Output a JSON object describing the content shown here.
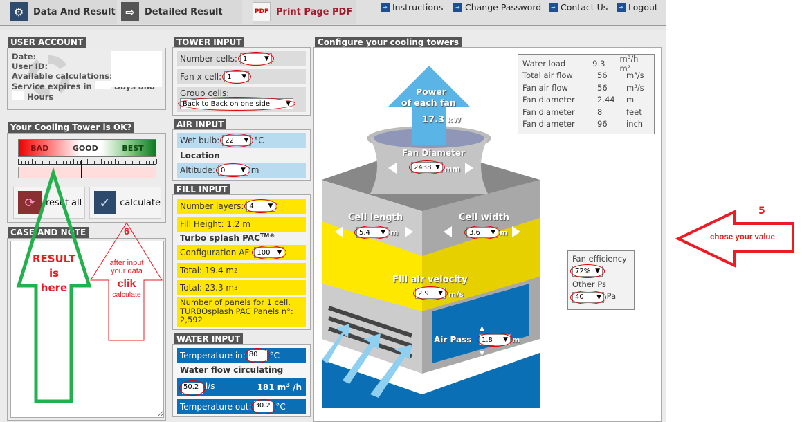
{
  "nav": {
    "tabs": [
      {
        "label": "Data And Result",
        "icon": "gear-icon"
      },
      {
        "label": "Detailed Result",
        "icon": "arrow-right-icon"
      },
      {
        "label": "Print Page PDF",
        "icon": "pdf-icon"
      }
    ],
    "links": [
      "Instructions",
      "Change Password",
      "Contact Us",
      "Logout"
    ]
  },
  "user_account": {
    "title": "USER ACCOUNT",
    "date_label": "Date:",
    "userid_label": "User ID:",
    "calcs_label": "Available calculations:",
    "expires_prefix": "Service expires in",
    "days_label": "Days and",
    "hours_label": "Hours"
  },
  "status": {
    "title": "Your Cooling Tower is OK?",
    "scale": [
      "BAD",
      "GOOD",
      "BEST"
    ],
    "indicator_fraction": 0.45,
    "reset_label": "reset all",
    "calculate_label": "calculate"
  },
  "case_note": {
    "title": "CASE AND NOTE",
    "value": ""
  },
  "tower_input": {
    "title": "TOWER INPUT",
    "number_cells_label": "Number cells:",
    "number_cells": "1",
    "fan_cell_label": "Fan x cell:",
    "fan_cell": "1",
    "group_cells_label": "Group cells:",
    "group_cells": "Back to Back on one side"
  },
  "air_input": {
    "title": "AIR INPUT",
    "wet_bulb_label": "Wet bulb:",
    "wet_bulb": "22",
    "wet_bulb_unit": "°C",
    "location_label": "Location",
    "altitude_label": "Altitude:",
    "altitude": "0",
    "altitude_unit": "m"
  },
  "fill_input": {
    "title": "FILL INPUT",
    "layers_label": "Number layers:",
    "layers": "4",
    "fill_height": "Fill Height: 1.2 m",
    "product": "Turbo splash PAC",
    "product_sup": "TM®",
    "config_label": "Configuration AF:",
    "config": "100",
    "total_area": "Total:  19.4 m",
    "total_area_sup": "2",
    "total_volume": "Total: 23.3 m",
    "total_volume_sup": "3",
    "panels_text": "Number of panels for 1 cell. TURBOsplash PAC Panels n°: 2,592"
  },
  "water_input": {
    "title": "WATER INPUT",
    "temp_in_label": "Temperature in:",
    "temp_in": "80",
    "temp_unit": "°C",
    "flow_label": "Water flow circulating",
    "flow": "50.2",
    "flow_unit": "l/s",
    "flow_m3h": "181 m",
    "flow_m3h_sup": "3",
    "flow_m3h_unit": " /h",
    "temp_out_label": "Temperature out:",
    "temp_out": "30.2"
  },
  "configure": {
    "title": "Configure your cooling towers",
    "power_label1": "Power",
    "power_label2": "of each fan",
    "power_value": "17.3",
    "power_unit": "kW",
    "fan_diameter_label": "Fan Diameter",
    "fan_diameter": "2438",
    "fan_diameter_unit": "mm",
    "cell_length_label": "Cell length",
    "cell_length": "5.4",
    "cell_width_label": "Cell width",
    "cell_width": "3.6",
    "len_unit": "m",
    "fill_velocity_label": "Fill air velocity",
    "fill_velocity": "2.9",
    "velocity_unit": "m/s",
    "air_pass_label": "Air Pass",
    "air_pass": "1.8"
  },
  "results": [
    {
      "label": "Water load",
      "value": "9.3",
      "unit": "m³/h m²"
    },
    {
      "label": "Total air flow",
      "value": "56",
      "unit": "m³/s"
    },
    {
      "label": "Fan air flow",
      "value": "56",
      "unit": "m³/s"
    },
    {
      "label": "Fan diameter",
      "value": "2.44",
      "unit": "m"
    },
    {
      "label": "Fan diameter",
      "value": "8",
      "unit": "feet"
    },
    {
      "label": "Fan diameter",
      "value": "96",
      "unit": "inch"
    }
  ],
  "fan_box": {
    "efficiency_label": "Fan efficiency",
    "efficiency": "72%",
    "other_ps_label": "Other Ps",
    "other_ps": "40",
    "other_ps_unit": "Pa"
  },
  "annotations": {
    "result_arrow": [
      "RESULT",
      "is",
      "here"
    ],
    "step6_number": "6",
    "step6_line1": "after input",
    "step6_line2": "your data",
    "step6_line3": "clik",
    "step6_line4": "calculate",
    "step5_number": "5",
    "step5_text": "chose your value"
  }
}
